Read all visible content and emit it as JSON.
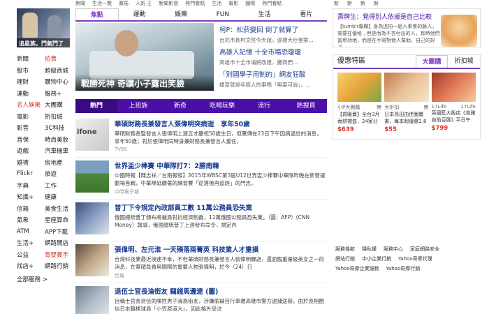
{
  "top_strip": [
    "新聞",
    "生活一覽",
    "賽馬",
    "人氣·王",
    "新聞影音",
    "熱門看點",
    "生活",
    "電影",
    "國際",
    "熱門看點"
  ],
  "top_strip2": [
    "新",
    "新",
    "新",
    "新"
  ],
  "promo": {
    "caption": "追星族，鬥氣鬥了"
  },
  "left_nav": [
    [
      "新聞",
      "拍賣"
    ],
    [
      "股市",
      "超級商城"
    ],
    [
      "理財",
      "購物中心"
    ],
    [
      "運動",
      "服務+"
    ],
    [
      "名人娛樂",
      "大團購"
    ],
    [
      "電影",
      "折扣城"
    ],
    [
      "影音",
      "3C科技"
    ],
    [
      "音保",
      "時尚美妝"
    ],
    [
      "遊戲",
      "汽車機車"
    ],
    [
      "婚禮",
      "房地產"
    ],
    [
      "Flickr",
      "旅遊"
    ],
    [
      "字典",
      "工作"
    ],
    [
      "知識+",
      "健康"
    ],
    [
      "信箱",
      "美食生活"
    ],
    [
      "氣象",
      "星座算命"
    ],
    [
      "ATM",
      "APP下載"
    ],
    [
      "生活+",
      "網路開店"
    ],
    [
      "公益",
      "育嬰寶手"
    ],
    [
      "找店+",
      "網路行銷"
    ]
  ],
  "left_nav_red": [
    "拍賣",
    "名人娛樂",
    "育嬰寶手"
  ],
  "left_nav_more": "全部服務 >",
  "tabs1": [
    "焦點",
    "運動",
    "娛樂",
    "FUN",
    "生活",
    "看片"
  ],
  "spotlight": {
    "caption": "戰勝死神 奇蹟小子露出笑臉",
    "items": [
      {
        "title": "柯P：松菸變回 倒了就算了",
        "desc": "台北市長柯文哲今天說，遠雄大巨蛋案..."
      },
      {
        "title": "高雄人記憶 十全市場恐瓊瓊",
        "desc": "高雄市十全市場將改建，攤商們..."
      },
      {
        "title": "「別國學子用制的」網友狂酸",
        "desc": "揉草就是年輕人的事嗎「無菜可說」，..."
      }
    ]
  },
  "tabs2": [
    "熱門",
    "上班族",
    "新奇",
    "吃喝玩樂",
    "流行",
    "熱搜頁"
  ],
  "news": [
    {
      "title": "華碩財務長兼發言人張偉明突病逝　享年50歲",
      "desc": "華碩財務長暨發言人張偉明上週五才慶祝50歲生日，但驚傳在23日下午因病過世的消息，享年50歲；對於張偉明同時身兼財務長兼發言人重任，",
      "source": "TVBS"
    },
    {
      "title": "世界盃少棒賽 中華隊打7：2勝南韓",
      "desc": "中國時報【陳志祥／台南報導】2015年WBSC第3屆U12世界盃少棒賽中華隊昨晚在新營運動場首戰，中華隊延續著的練習賽「從落後再追趕」的門志，",
      "source": "中時電子報"
    },
    {
      "title": "普丁下令規定內政部員工數 11萬公務員恐失業",
      "desc": "俄國總統普丁頒布將裁員對抗經濟制裁，11萬俄國公務員恐失業。（圖：AFP）(CNN Money）報導，俄國總統普丁上週發布命令，規定內",
      "source": ""
    },
    {
      "title": "張偉明、左元淮 一天殞落兩菁英 科技業人才重損",
      "desc": "台灣科技業最近接連不幸，不但華碩財務長兼發言人張偉明驟逝，還面臨重量級美女之一的消息，在華碩負責與國際的重要人物張偉明，於今（24）日",
      "source": "民報"
    },
    {
      "title": "退伍士官長淪街友 竊錢馬邊逮 (圖)",
      "desc": "自稱士官長退伍的陳姓男子淪為街友，涉嫌偷竊自行車遭高雄市警方逮捕送辦，由於長相酷似日本職棒球員「小笠原道大」，因此格外受注",
      "source": ""
    }
  ],
  "right_ad": {
    "title": "壽牌生：覺得別人依據是自己比較",
    "desc": "【tumblr專欄】身為追拍一組人事會的藝人，需要在優格 , 但是而為不吝付出的人，有時他們當用功地，而是在手寫對他人幫助，自己的好了..."
  },
  "deals": {
    "title": "優惠特區",
    "tabs": [
      "大團購",
      "折扣城"
    ],
    "items": [
      {
        "shop": "小P大團購",
        "price_label": "$639",
        "name": "【買暖賣】全台3月香餅禮盒，24家分店通用...",
        "tag": "無"
      },
      {
        "shop": "大折扣",
        "price_label": "$55",
        "name": "日本島田由佳圖畫書，每本超優惠2.8折",
        "tag": "無"
      },
      {
        "shop": "17Life",
        "price_label": "$799",
        "name": "英國藍大飯店《吉雅自助百匯》平日午餐...",
        "tag": "17Life"
      }
    ]
  },
  "footer_links": [
    [
      "服務條款",
      "隱私權",
      "服務中心",
      "家庭網路安全"
    ],
    [
      "網站行銷",
      "中小企業行銷",
      "Yahoo奇摩代理"
    ],
    [
      "Yahoo奇摩企業服務",
      "Yahoo奇摩行銷"
    ]
  ]
}
